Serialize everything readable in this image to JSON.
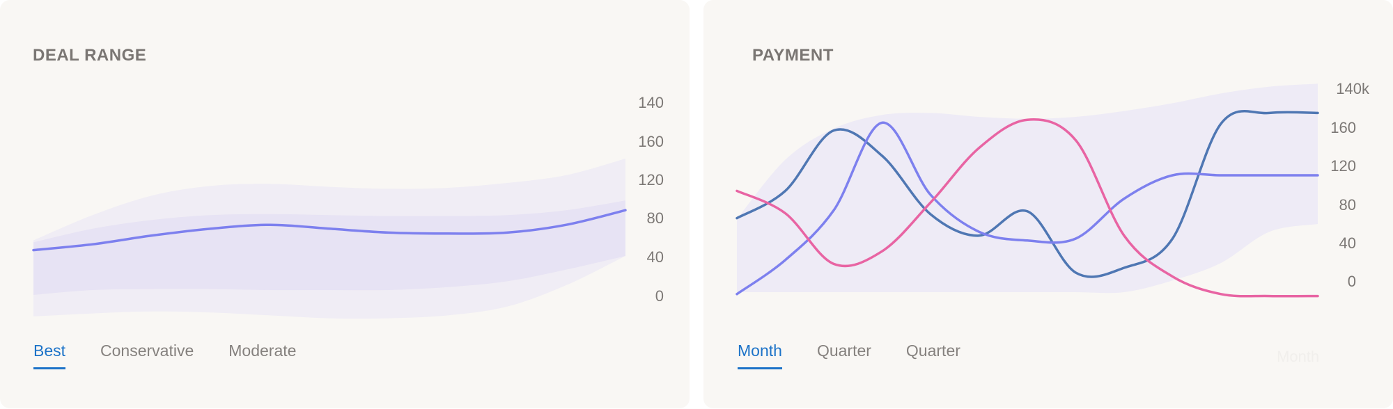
{
  "deal_range": {
    "title": "DEAL RANGE",
    "tabs": [
      "Best",
      "Conservative",
      "Moderate"
    ],
    "active_tab": 0
  },
  "payment": {
    "title": "PAYMENT",
    "tabs": [
      "Month",
      "Quarter",
      "Quarter"
    ],
    "active_tab": 0,
    "faded_label": "Month"
  },
  "colors": {
    "band_light": "#ece9f6",
    "band_mid": "#e5e1f3",
    "line_purple": "#7d80ee",
    "line_blue": "#4f77b3",
    "line_pink": "#e864a3",
    "accent": "#1d73c8"
  },
  "chart_data": [
    {
      "type": "area",
      "title": "DEAL RANGE",
      "y_tick_labels": [
        "140",
        "160",
        "120",
        "80",
        "40",
        "0"
      ],
      "x": [
        0,
        1,
        2,
        3,
        4,
        5,
        6,
        7,
        8,
        9,
        10
      ],
      "series": [
        {
          "values": [
            46,
            52,
            61,
            68,
            72,
            68,
            64,
            63,
            64,
            72,
            87
          ]
        }
      ],
      "bands": [
        {
          "lower": [
            -22,
            -19,
            -17,
            -18,
            -21,
            -24,
            -24,
            -21,
            -12,
            10,
            40
          ],
          "upper": [
            56,
            82,
            102,
            112,
            114,
            111,
            109,
            110,
            115,
            123,
            140
          ]
        },
        {
          "lower": [
            0,
            5,
            6,
            6,
            5,
            5,
            5,
            8,
            14,
            26,
            40
          ],
          "upper": [
            54,
            68,
            77,
            82,
            83,
            82,
            81,
            81,
            82,
            87,
            97
          ]
        }
      ],
      "grid": false
    },
    {
      "type": "line",
      "title": "PAYMENT",
      "y_tick_labels": [
        "140k",
        "160",
        "120",
        "80",
        "40",
        "0"
      ],
      "x": [
        0,
        1,
        2,
        3,
        4,
        5,
        6,
        7,
        8,
        9,
        10,
        11,
        12
      ],
      "series": [
        {
          "color": "blue",
          "values": [
            76,
            104,
            166,
            140,
            80,
            58,
            83,
            20,
            25,
            55,
            173,
            184,
            184
          ]
        },
        {
          "color": "purple",
          "values": [
            -2,
            33,
            84,
            174,
            100,
            62,
            53,
            55,
            96,
            120,
            120,
            120,
            120
          ]
        },
        {
          "color": "pink",
          "values": [
            104,
            81,
            29,
            42,
            92,
            148,
            177,
            156,
            58,
            16,
            -2,
            -4,
            -4
          ]
        }
      ],
      "band": {
        "lower": [
          0,
          0,
          0,
          0,
          0,
          0,
          0,
          0,
          0,
          12,
          30,
          62,
          70
        ],
        "upper": [
          75,
          136,
          168,
          182,
          184,
          180,
          178,
          180,
          186,
          194,
          204,
          211,
          214
        ]
      },
      "grid": false
    }
  ]
}
